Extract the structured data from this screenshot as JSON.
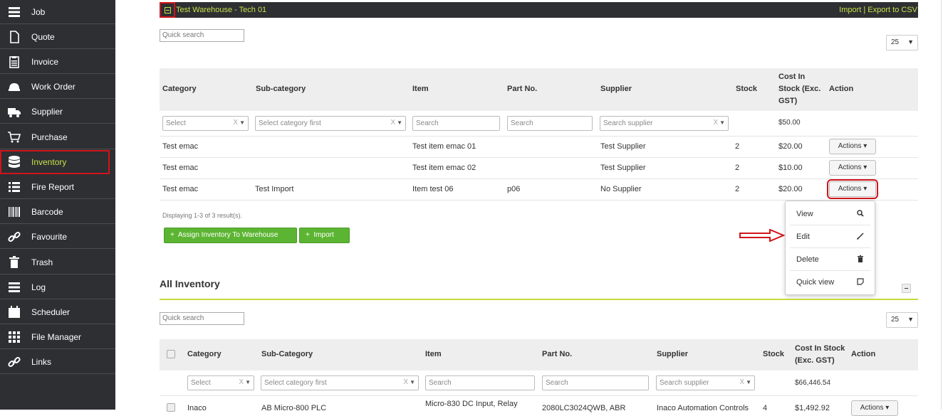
{
  "sidebar": {
    "items": [
      {
        "label": "Job",
        "icon": "job-icon"
      },
      {
        "label": "Quote",
        "icon": "document-icon"
      },
      {
        "label": "Invoice",
        "icon": "clipboard-icon"
      },
      {
        "label": "Work Order",
        "icon": "hardhat-icon"
      },
      {
        "label": "Supplier",
        "icon": "truck-icon"
      },
      {
        "label": "Purchase",
        "icon": "cart-icon"
      },
      {
        "label": "Inventory",
        "icon": "database-icon"
      },
      {
        "label": "Fire Report",
        "icon": "list-icon"
      },
      {
        "label": "Barcode",
        "icon": "barcode-icon"
      },
      {
        "label": "Favourite",
        "icon": "link-icon"
      },
      {
        "label": "Trash",
        "icon": "trash-icon"
      },
      {
        "label": "Log",
        "icon": "log-icon"
      },
      {
        "label": "Scheduler",
        "icon": "calendar-icon"
      },
      {
        "label": "File Manager",
        "icon": "grid-icon"
      },
      {
        "label": "Links",
        "icon": "link-icon"
      }
    ],
    "active": "Inventory"
  },
  "warehouse": {
    "title": "Test Warehouse - Tech 01",
    "links": "Import | Export to CSV",
    "quick_search": "Quick search",
    "page_size": "25",
    "columns": [
      "Category",
      "Sub-category",
      "Item",
      "Part No.",
      "Supplier",
      "Stock",
      "Cost In Stock (Exc. GST)",
      "Action"
    ],
    "filters": {
      "category": "Select",
      "subcategory": "Select category first",
      "item": "Search",
      "partno": "Search",
      "supplier": "Search supplier",
      "total": "$50.00"
    },
    "rows": [
      {
        "category": "Test emac",
        "subcategory": "",
        "item": "Test item emac 01",
        "partno": "",
        "supplier": "Test Supplier",
        "stock": "2",
        "cost": "$20.00",
        "action": "Actions"
      },
      {
        "category": "Test emac",
        "subcategory": "",
        "item": "Test item emac 02",
        "partno": "",
        "supplier": "Test Supplier",
        "stock": "2",
        "cost": "$10.00",
        "action": "Actions"
      },
      {
        "category": "Test emac",
        "subcategory": "Test Import",
        "item": "Item test 06",
        "partno": "p06",
        "supplier": "No Supplier",
        "stock": "2",
        "cost": "$20.00",
        "action": "Actions"
      }
    ],
    "summary": "Displaying 1-3 of 3 result(s).",
    "buttons": {
      "assign": "Assign Inventory To Warehouse",
      "import": "Import"
    }
  },
  "action_menu": {
    "items": [
      {
        "label": "View",
        "icon": "search-icon"
      },
      {
        "label": "Edit",
        "icon": "pencil-icon"
      },
      {
        "label": "Delete",
        "icon": "trash-icon"
      },
      {
        "label": "Quick view",
        "icon": "note-icon"
      }
    ]
  },
  "all_inventory": {
    "title": "All Inventory",
    "quick_search": "Quick search",
    "page_size": "25",
    "columns": [
      "Category",
      "Sub-Category",
      "Item",
      "Part No.",
      "Supplier",
      "Stock",
      "Cost In Stock (Exc. GST)",
      "Action"
    ],
    "filters": {
      "category": "Select",
      "subcategory": "Select category first",
      "item": "Search",
      "partno": "Search",
      "supplier": "Search supplier",
      "total": "$66,446.54"
    },
    "rows": [
      {
        "category": "Inaco",
        "subcategory": "AB Micro-800 PLC",
        "item": "Micro-830 DC Input, Relay",
        "partno": "2080LC3024QWB, ABR",
        "supplier": "Inaco Automation Controls",
        "stock": "4",
        "cost": "$1,492.92",
        "action": "Actions"
      }
    ]
  },
  "colors": {
    "sidebar_bg": "#2d2f33",
    "accent": "#c8e04a",
    "highlight": "#d0141b",
    "button_green": "#5cb532"
  }
}
